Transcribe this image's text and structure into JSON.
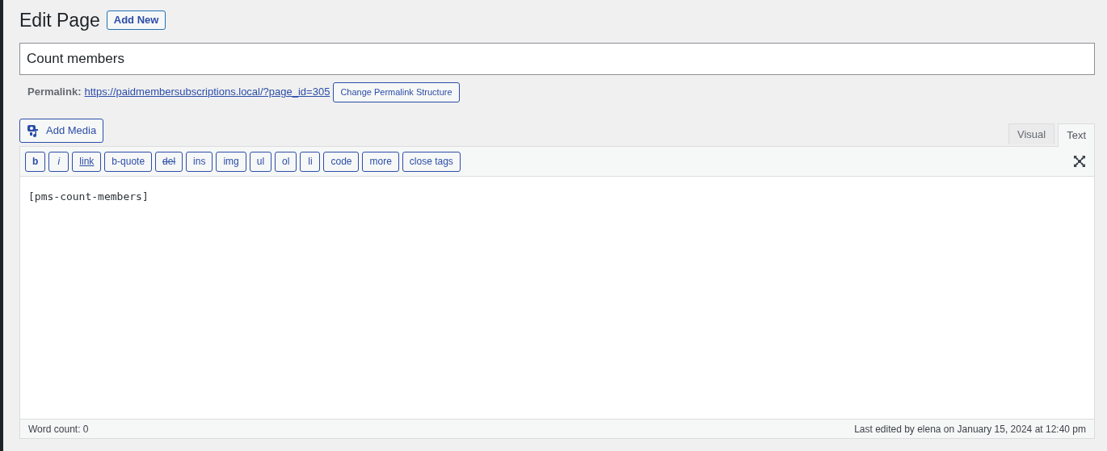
{
  "heading": "Edit Page",
  "add_new_button": "Add New",
  "title_field": {
    "value": "Count members"
  },
  "permalink": {
    "label": "Permalink:",
    "url": "https://paidmembersubscriptions.local/?page_id=305",
    "button": "Change Permalink Structure"
  },
  "add_media_button": "Add Media",
  "editor_tabs": [
    {
      "label": "Visual",
      "selected": false
    },
    {
      "label": "Text",
      "selected": true
    }
  ],
  "quicktags": [
    {
      "label": "b",
      "kind": "bold"
    },
    {
      "label": "i",
      "kind": "italic"
    },
    {
      "label": "link",
      "kind": "link"
    },
    {
      "label": "b-quote",
      "kind": "plain"
    },
    {
      "label": "del",
      "kind": "strike"
    },
    {
      "label": "ins",
      "kind": "plain"
    },
    {
      "label": "img",
      "kind": "plain"
    },
    {
      "label": "ul",
      "kind": "plain"
    },
    {
      "label": "ol",
      "kind": "plain"
    },
    {
      "label": "li",
      "kind": "plain"
    },
    {
      "label": "code",
      "kind": "plain"
    },
    {
      "label": "more",
      "kind": "plain"
    },
    {
      "label": "close tags",
      "kind": "plain"
    }
  ],
  "editor_content": "[pms-count-members]",
  "status_bar": {
    "word_count": "Word count: 0",
    "last_edited": "Last edited by elena on January 15, 2024 at 12:40 pm"
  }
}
